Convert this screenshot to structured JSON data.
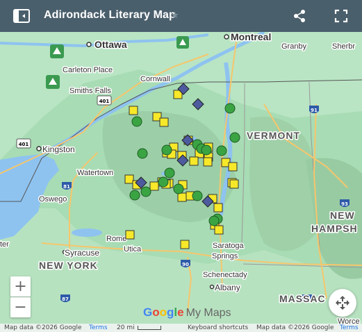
{
  "header": {
    "title": "Adirondack Literary Map",
    "star_glyph": "★"
  },
  "labels": {
    "montreal": "Montreal",
    "ottawa": "Ottawa",
    "granby": "Granby",
    "sherbrooke": "Sherbr",
    "carleton_place": "Carleton Place",
    "cornwall": "Cornwall",
    "smiths_falls": "Smiths Falls",
    "kingston": "Kingston",
    "watertown": "Watertown",
    "vermont": "VERMONT",
    "oswego": "Oswego",
    "rome": "Rome",
    "utica": "Utica",
    "syracuse": "Syracuse",
    "new_york": "NEW YORK",
    "saratoga": "Saratoga",
    "springs": "Springs",
    "schenectady": "Schenectady",
    "albany": "Albany",
    "new_hampshire_1": "NEW",
    "new_hampshire_2": "HAMPSH",
    "massachusetts": "MASSAC",
    "worcester": "Worce",
    "rochester_stub": "ter",
    "hwy_401a": "401",
    "hwy_401b": "401",
    "hwy_81": "81",
    "hwy_90": "90",
    "hwy_91": "91",
    "hwy_93": "93",
    "hwy_87": "87",
    "hwy_89": "89"
  },
  "zoom": {
    "in": "+",
    "out": "−"
  },
  "logo": {
    "google": "Google",
    "my_maps": "My Maps"
  },
  "footer": {
    "map_data_left": "Map data ©2026 Google",
    "terms_left": "Terms",
    "scale": "20 mi",
    "keyboard": "Keyboard shortcuts",
    "map_data_right": "Map data ©2026 Google",
    "terms_right": "Terms"
  },
  "marker_colors": {
    "square": "#f7e829",
    "circle": "#3aa443",
    "diamond": "#4d5b9e"
  },
  "legend_icons": [
    "drawer-icon",
    "share-icon",
    "fullscreen-icon"
  ]
}
